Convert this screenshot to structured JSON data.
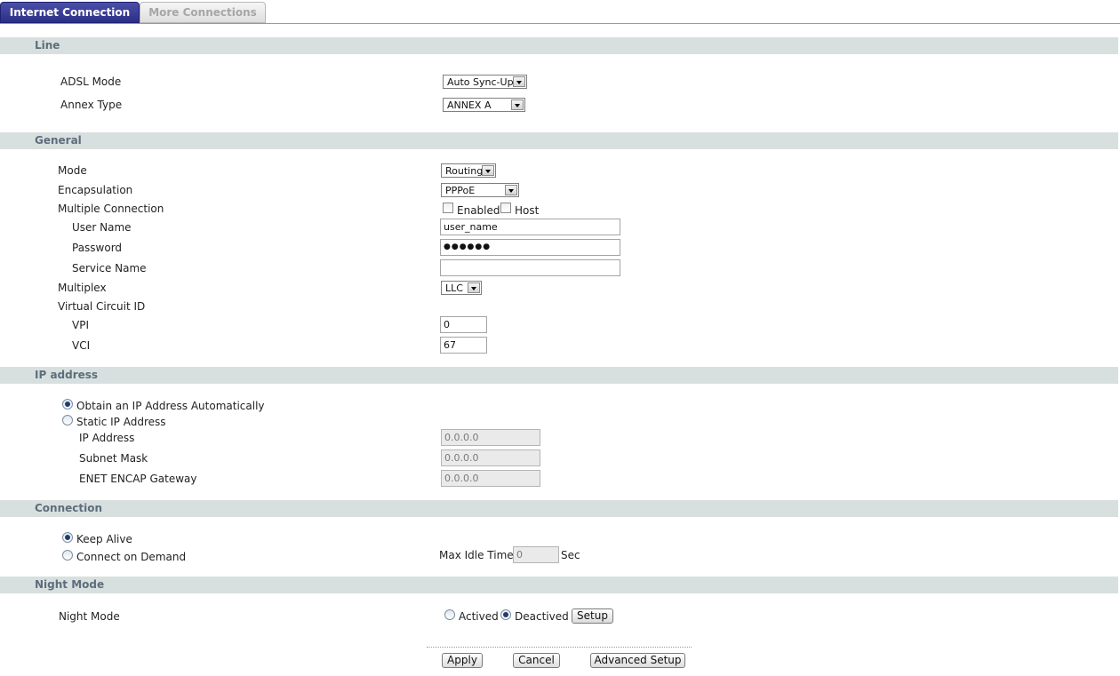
{
  "tabs": {
    "active": "Internet Connection",
    "inactive": "More Connections"
  },
  "line": {
    "title": "Line",
    "adsl_mode_label": "ADSL Mode",
    "adsl_mode_value": "Auto Sync-Up",
    "annex_label": "Annex Type",
    "annex_value": "ANNEX A"
  },
  "general": {
    "title": "General",
    "mode_label": "Mode",
    "mode_value": "Routing",
    "encap_label": "Encapsulation",
    "encap_value": "PPPoE",
    "multi_label": "Multiple Connection",
    "enabled_label": "Enabled",
    "host_label": "Host",
    "user_label": "User Name",
    "user_value": "user_name",
    "pass_label": "Password",
    "pass_value": "●●●●●●",
    "service_label": "Service Name",
    "service_value": "",
    "multiplex_label": "Multiplex",
    "multiplex_value": "LLC",
    "vc_label": "Virtual Circuit ID",
    "vpi_label": "VPI",
    "vpi_value": "0",
    "vci_label": "VCI",
    "vci_value": "67"
  },
  "ip": {
    "title": "IP address",
    "auto_label": "Obtain an IP Address Automatically",
    "static_label": "Static IP Address",
    "ip_label": "IP Address",
    "ip_value": "0.0.0.0",
    "mask_label": "Subnet Mask",
    "mask_value": "0.0.0.0",
    "gw_label": "ENET ENCAP Gateway",
    "gw_value": "0.0.0.0"
  },
  "connection": {
    "title": "Connection",
    "keep_alive_label": "Keep Alive",
    "on_demand_label": "Connect on Demand",
    "idle_label": "Max Idle Time",
    "idle_value": "0",
    "idle_unit": "Sec"
  },
  "night": {
    "title": "Night Mode",
    "label": "Night Mode",
    "actived_label": "Actived",
    "deactived_label": "Deactived",
    "setup_label": "Setup"
  },
  "footer": {
    "apply": "Apply",
    "cancel": "Cancel",
    "advanced": "Advanced Setup"
  }
}
